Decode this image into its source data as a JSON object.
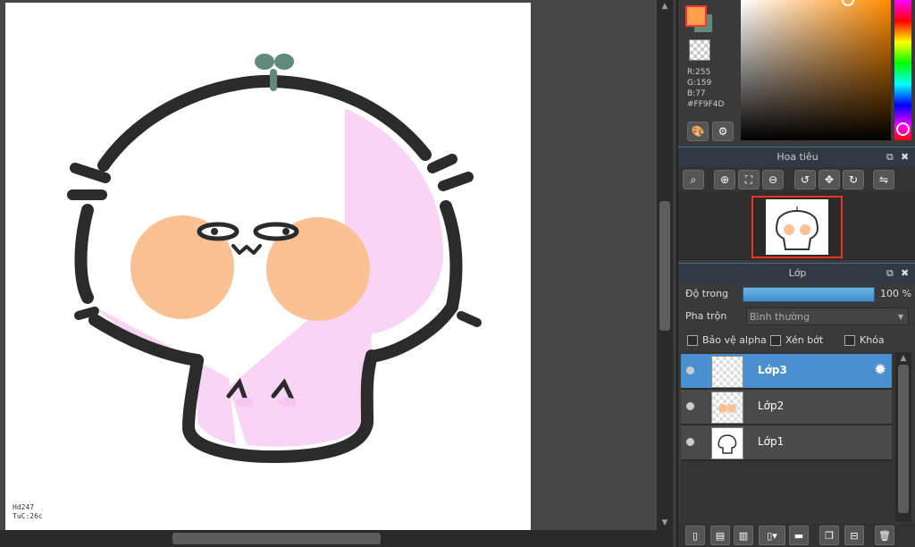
{
  "canvas": {
    "signature_line1": "Hd247",
    "signature_line2": "TuC:26c"
  },
  "color_panel": {
    "fg_color": "#ff9f4d",
    "bg_color": "#5f8a7c",
    "r": "R:255",
    "g": "G:159",
    "b": "B:77",
    "hex": "#FF9F4D"
  },
  "navigator": {
    "title": "Hoa tiêu"
  },
  "layer_panel": {
    "title": "Lớp",
    "opacity_label": "Độ trong",
    "opacity_value": "100 %",
    "blend_label": "Pha trộn",
    "blend_value": "Bình thường",
    "protect_alpha": "Bảo vệ alpha",
    "clipping": "Xén bớt",
    "lock": "Khóa",
    "layers": [
      {
        "name": "Lớp3",
        "active": true
      },
      {
        "name": "Lớp2",
        "active": false
      },
      {
        "name": "Lớp1",
        "active": false
      }
    ]
  }
}
